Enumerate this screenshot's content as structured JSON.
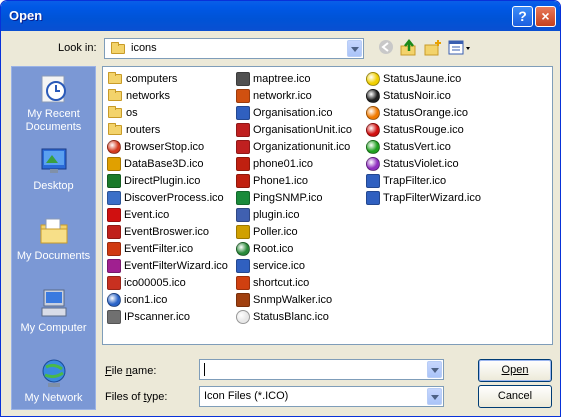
{
  "window": {
    "title": "Open"
  },
  "toolbar": {
    "look_in_label": "Look in:",
    "look_in_value": "icons"
  },
  "places": [
    {
      "label": "My Recent Documents",
      "icon": "recent-documents-icon"
    },
    {
      "label": "Desktop",
      "icon": "desktop-icon"
    },
    {
      "label": "My Documents",
      "icon": "my-documents-icon"
    },
    {
      "label": "My Computer",
      "icon": "my-computer-icon"
    },
    {
      "label": "My Network",
      "icon": "my-network-icon"
    }
  ],
  "files": {
    "col1": [
      {
        "name": "computers",
        "icon": "folder-icon",
        "color": "#f3d36b"
      },
      {
        "name": "networks",
        "icon": "folder-icon",
        "color": "#f3d36b"
      },
      {
        "name": "os",
        "icon": "folder-icon",
        "color": "#f3d36b"
      },
      {
        "name": "routers",
        "icon": "folder-icon",
        "color": "#f3d36b"
      },
      {
        "name": "BrowserStop.ico",
        "icon": "stop-icon",
        "color": "#d43b20"
      },
      {
        "name": "DataBase3D.ico",
        "icon": "database-icon",
        "color": "#e0a000"
      },
      {
        "name": "DirectPlugin.ico",
        "icon": "plugin-icon",
        "color": "#1a7a2a"
      },
      {
        "name": "DiscoverProcess.ico",
        "icon": "discover-icon",
        "color": "#3a6fc8"
      },
      {
        "name": "Event.ico",
        "icon": "event-icon",
        "color": "#d01010"
      },
      {
        "name": "EventBroswer.ico",
        "icon": "event-browser-icon",
        "color": "#c0201a"
      },
      {
        "name": "EventFilter.ico",
        "icon": "event-filter-icon",
        "color": "#d03a10"
      },
      {
        "name": "EventFilterWizard.ico",
        "icon": "event-filter-wizard-icon",
        "color": "#a02090"
      },
      {
        "name": "ico00005.ico",
        "icon": "image-icon",
        "color": "#c83020"
      },
      {
        "name": "icon1.ico",
        "icon": "globe-icon",
        "color": "#2a64c8"
      },
      {
        "name": "IPscanner.ico",
        "icon": "scanner-icon",
        "color": "#707070"
      }
    ],
    "col2": [
      {
        "name": "maptree.ico",
        "icon": "tree-icon",
        "color": "#505050"
      },
      {
        "name": "networkr.ico",
        "icon": "network-icon",
        "color": "#d05010"
      },
      {
        "name": "Organisation.ico",
        "icon": "organisation-icon",
        "color": "#3060c0"
      },
      {
        "name": "OrganisationUnit.ico",
        "icon": "organisation-unit-icon",
        "color": "#c02020"
      },
      {
        "name": "Organizationunit.ico",
        "icon": "organization-unit-icon",
        "color": "#c02020"
      },
      {
        "name": "phone01.ico",
        "icon": "phone-icon",
        "color": "#c02010"
      },
      {
        "name": "Phone1.ico",
        "icon": "phone-icon",
        "color": "#c02010"
      },
      {
        "name": "PingSNMP.ico",
        "icon": "ping-icon",
        "color": "#1a8a3a"
      },
      {
        "name": "plugin.ico",
        "icon": "plugin-icon",
        "color": "#4060b0"
      },
      {
        "name": "Poller.ico",
        "icon": "poller-icon",
        "color": "#d0a000"
      },
      {
        "name": "Root.ico",
        "icon": "root-globe-icon",
        "color": "#2a8a3a"
      },
      {
        "name": "service.ico",
        "icon": "service-icon",
        "color": "#3060c0"
      },
      {
        "name": "shortcut.ico",
        "icon": "shortcut-icon",
        "color": "#d04010"
      },
      {
        "name": "SnmpWalker.ico",
        "icon": "walker-icon",
        "color": "#a04010"
      },
      {
        "name": "StatusBlanc.ico",
        "icon": "status-white-icon",
        "color": "#e8e8e8"
      }
    ],
    "col3": [
      {
        "name": "StatusJaune.ico",
        "icon": "status-yellow-icon",
        "color": "#f0d000"
      },
      {
        "name": "StatusNoir.ico",
        "icon": "status-black-icon",
        "color": "#202020"
      },
      {
        "name": "StatusOrange.ico",
        "icon": "status-orange-icon",
        "color": "#f07a00"
      },
      {
        "name": "StatusRouge.ico",
        "icon": "status-red-icon",
        "color": "#d01010"
      },
      {
        "name": "StatusVert.ico",
        "icon": "status-green-icon",
        "color": "#20a020"
      },
      {
        "name": "StatusViolet.ico",
        "icon": "status-violet-icon",
        "color": "#9030c0"
      },
      {
        "name": "TrapFilter.ico",
        "icon": "trap-filter-icon",
        "color": "#3060c0"
      },
      {
        "name": "TrapFilterWizard.ico",
        "icon": "trap-filter-wizard-icon",
        "color": "#3060c0"
      }
    ]
  },
  "form": {
    "file_name_label": "File name:",
    "file_name_value": "",
    "file_type_label": "Files of type:",
    "file_type_value": "Icon Files (*.ICO)"
  },
  "buttons": {
    "open": "Open",
    "cancel": "Cancel",
    "help": "?",
    "close": "×"
  }
}
